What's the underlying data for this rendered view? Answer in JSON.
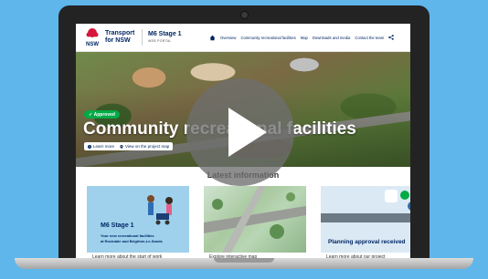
{
  "header": {
    "brand_line1": "Transport",
    "brand_line2": "for NSW",
    "logo_text": "NSW",
    "site_title": "M6 Stage 1",
    "site_subtitle": "WEB PORTAL",
    "nav": [
      "Overview",
      "Community recreational facilities",
      "Map",
      "Downloads and media",
      "Contact the team"
    ]
  },
  "hero": {
    "badge": "Approved",
    "title": "Community recreational facilities",
    "buttons": [
      "Learn more",
      "View on the project map"
    ]
  },
  "latest": {
    "heading": "Latest information",
    "cards": [
      {
        "image_title": "M6 Stage 1",
        "image_lines": [
          "Your new recreational facilities",
          "at Rockdale and Brighton-Le-Sands"
        ],
        "caption": "Learn more about the start of work"
      },
      {
        "caption": "Explore interactive map"
      },
      {
        "image_title": "Planning approval received",
        "caption": "Learn more about our project"
      }
    ]
  },
  "colors": {
    "background": "#5fb6ea",
    "navy": "#002664",
    "approved": "#00aa45",
    "nsw_red": "#d7153a"
  },
  "icons": [
    "home-icon",
    "share-icon",
    "play-icon",
    "info-icon",
    "map-pin-icon"
  ]
}
